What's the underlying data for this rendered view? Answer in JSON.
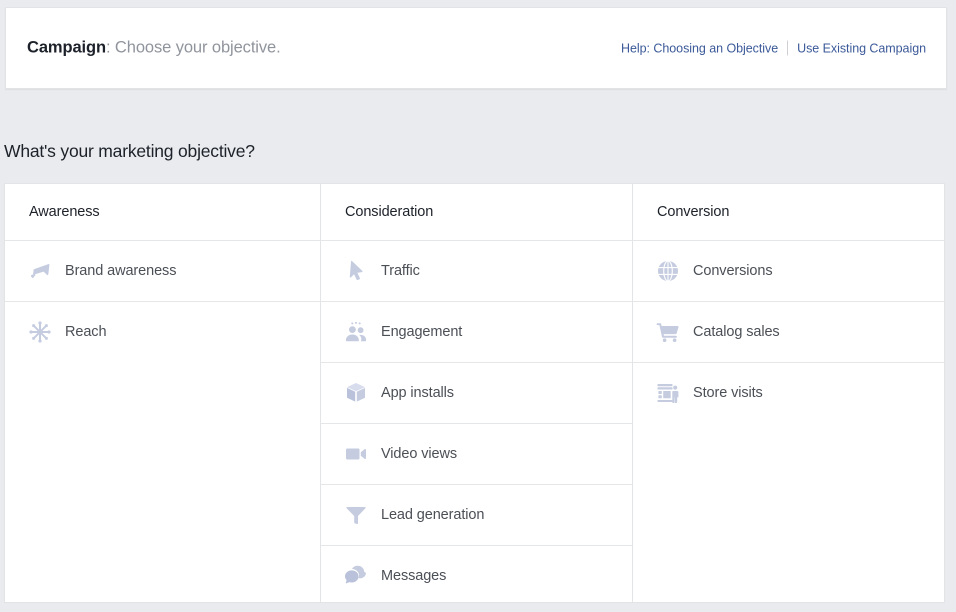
{
  "header": {
    "title_strong": "Campaign",
    "title_rest": ": Choose your objective.",
    "links": [
      {
        "label": "Help: Choosing an Objective",
        "name": "help-choosing-objective-link"
      },
      {
        "label": "Use Existing Campaign",
        "name": "use-existing-campaign-link"
      }
    ]
  },
  "section": {
    "heading": "What's your marketing objective?"
  },
  "columns": [
    {
      "header": "Awareness",
      "items": [
        {
          "label": "Brand awareness",
          "icon": "megaphone-icon"
        },
        {
          "label": "Reach",
          "icon": "starburst-icon"
        }
      ]
    },
    {
      "header": "Consideration",
      "items": [
        {
          "label": "Traffic",
          "icon": "cursor-arrow-icon"
        },
        {
          "label": "Engagement",
          "icon": "people-icon"
        },
        {
          "label": "App installs",
          "icon": "cube-box-icon"
        },
        {
          "label": "Video views",
          "icon": "video-camera-icon"
        },
        {
          "label": "Lead generation",
          "icon": "funnel-icon"
        },
        {
          "label": "Messages",
          "icon": "speech-bubbles-icon"
        }
      ]
    },
    {
      "header": "Conversion",
      "items": [
        {
          "label": "Conversions",
          "icon": "globe-icon"
        },
        {
          "label": "Catalog sales",
          "icon": "shopping-cart-icon"
        },
        {
          "label": "Store visits",
          "icon": "storefront-icon"
        }
      ]
    }
  ],
  "colors": {
    "page_background": "#e9ebee",
    "card_background": "#ffffff",
    "link": "#3b5998",
    "icon": "#c5cce0",
    "text_primary": "#1d2129",
    "text_secondary": "#4b4f56",
    "text_muted": "#90949c",
    "border": "#e3e4e6"
  }
}
